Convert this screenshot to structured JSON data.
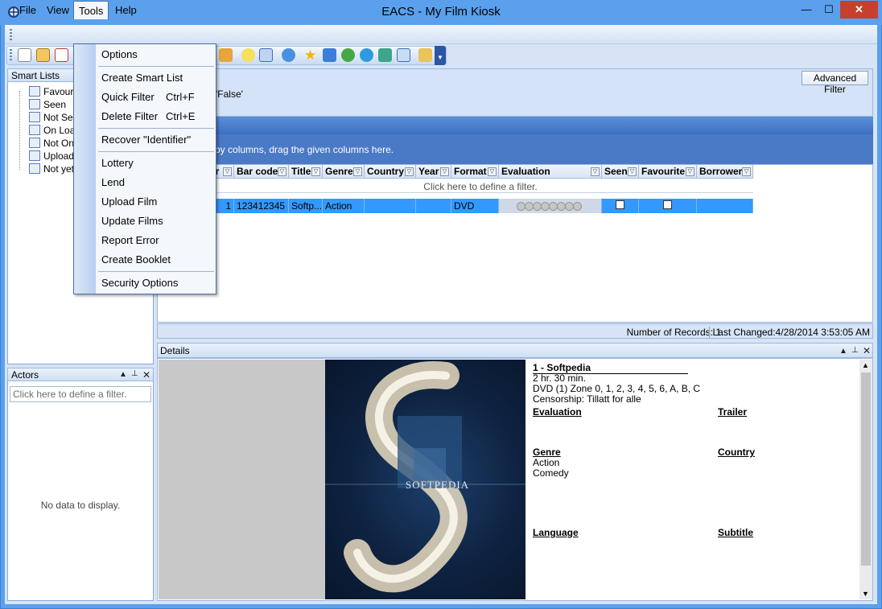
{
  "window": {
    "title": "EACS - My Film Kiosk",
    "min_glyph": "—",
    "max_glyph": "☐",
    "close_glyph": "✕"
  },
  "menubar": {
    "items": [
      "File",
      "View",
      "Tools",
      "Help"
    ]
  },
  "tools_menu": {
    "items": [
      {
        "label": "Options",
        "shortcut": ""
      },
      {
        "label": "Create Smart List",
        "shortcut": ""
      },
      {
        "label": "Quick Filter",
        "shortcut": "Ctrl+F"
      },
      {
        "label": "Delete Filter",
        "shortcut": "Ctrl+E"
      },
      {
        "label": "Recover \"Identifier\"",
        "shortcut": ""
      },
      {
        "label": "Lottery",
        "shortcut": ""
      },
      {
        "label": "Lend",
        "shortcut": ""
      },
      {
        "label": "Upload Film",
        "shortcut": ""
      },
      {
        "label": "Update Films",
        "shortcut": ""
      },
      {
        "label": "Report Error",
        "shortcut": ""
      },
      {
        "label": "Create Booklet",
        "shortcut": ""
      },
      {
        "label": "Security Options",
        "shortcut": ""
      }
    ]
  },
  "smart_lists": {
    "title": "Smart Lists",
    "items": [
      "Favouri",
      "Seen",
      "Not See",
      "On Loan",
      "Not On",
      "Uploade",
      "Not yet"
    ]
  },
  "actors": {
    "title": "Actors",
    "filter_placeholder": "Click here to define a filter.",
    "empty_text": "No data to display."
  },
  "filter": {
    "advanced_button": "Advanced Filter",
    "text": "o 'False'"
  },
  "grid": {
    "group_hint": "a by columns, drag the given columns here.",
    "filter_row": "Click here to define a filter.",
    "columns": [
      "er",
      "Bar code",
      "Title",
      "Genre",
      "Country",
      "Year",
      "Format",
      "Evaluation",
      "Seen",
      "Favourite",
      "Borrower"
    ],
    "rows": [
      {
        "number": "1",
        "barcode": "123412345",
        "title": "Softp...",
        "genre": "Action",
        "country": "",
        "year": "",
        "format": "DVD",
        "evaluation": 0,
        "seen": false,
        "favourite": false,
        "borrower": ""
      }
    ]
  },
  "status": {
    "records": "Number of Records: 1",
    "last_changed": "Last Changed:4/28/2014 3:53:05 AM"
  },
  "details": {
    "title": "Details",
    "film_title": "1 - Softpedia",
    "duration": "2 hr. 30 min.",
    "media": "DVD (1) Zone 0, 1, 2, 3, 4, 5, 6, A, B, C",
    "censorship": "Censorship: Tillatt for alle",
    "evaluation_label": "Evaluation",
    "trailer_label": "Trailer",
    "genre_label": "Genre",
    "genres": [
      "Action",
      "Comedy"
    ],
    "country_label": "Country",
    "language_label": "Language",
    "subtitle_label": "Subtitle",
    "poster_text": "SOFTPEDIA"
  }
}
